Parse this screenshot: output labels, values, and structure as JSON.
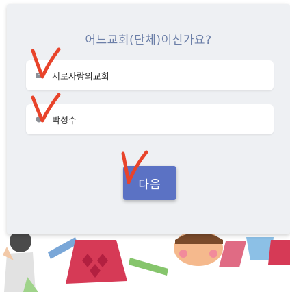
{
  "form": {
    "title": "어느교회(단체)이신가요?",
    "church_field": {
      "value": "서로사랑의교회",
      "icon": "building-icon"
    },
    "name_field": {
      "value": "박성수",
      "icon": "user-icon"
    },
    "next_label": "다음"
  },
  "colors": {
    "accent": "#5b72c4",
    "title": "#6c7fa8",
    "annotation": "#e8432a"
  }
}
